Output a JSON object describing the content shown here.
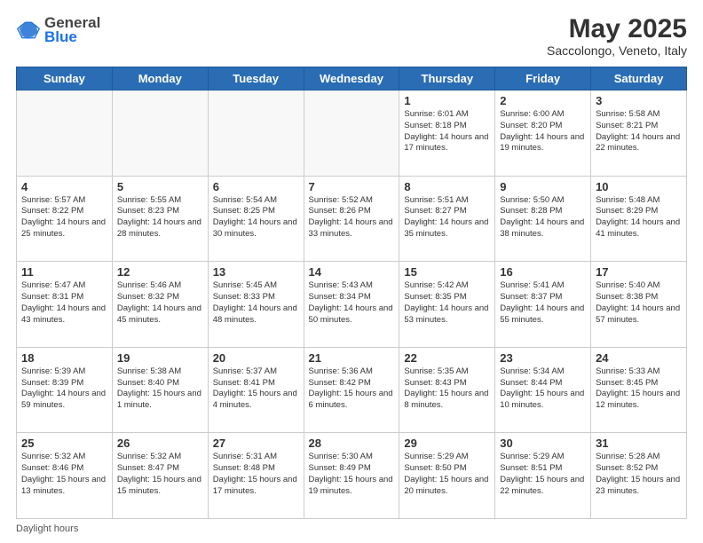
{
  "header": {
    "logo_general": "General",
    "logo_blue": "Blue",
    "month_title": "May 2025",
    "location": "Saccolongo, Veneto, Italy"
  },
  "days_of_week": [
    "Sunday",
    "Monday",
    "Tuesday",
    "Wednesday",
    "Thursday",
    "Friday",
    "Saturday"
  ],
  "weeks": [
    [
      {
        "day": "",
        "info": ""
      },
      {
        "day": "",
        "info": ""
      },
      {
        "day": "",
        "info": ""
      },
      {
        "day": "",
        "info": ""
      },
      {
        "day": "1",
        "info": "Sunrise: 6:01 AM\nSunset: 8:18 PM\nDaylight: 14 hours\nand 17 minutes."
      },
      {
        "day": "2",
        "info": "Sunrise: 6:00 AM\nSunset: 8:20 PM\nDaylight: 14 hours\nand 19 minutes."
      },
      {
        "day": "3",
        "info": "Sunrise: 5:58 AM\nSunset: 8:21 PM\nDaylight: 14 hours\nand 22 minutes."
      }
    ],
    [
      {
        "day": "4",
        "info": "Sunrise: 5:57 AM\nSunset: 8:22 PM\nDaylight: 14 hours\nand 25 minutes."
      },
      {
        "day": "5",
        "info": "Sunrise: 5:55 AM\nSunset: 8:23 PM\nDaylight: 14 hours\nand 28 minutes."
      },
      {
        "day": "6",
        "info": "Sunrise: 5:54 AM\nSunset: 8:25 PM\nDaylight: 14 hours\nand 30 minutes."
      },
      {
        "day": "7",
        "info": "Sunrise: 5:52 AM\nSunset: 8:26 PM\nDaylight: 14 hours\nand 33 minutes."
      },
      {
        "day": "8",
        "info": "Sunrise: 5:51 AM\nSunset: 8:27 PM\nDaylight: 14 hours\nand 35 minutes."
      },
      {
        "day": "9",
        "info": "Sunrise: 5:50 AM\nSunset: 8:28 PM\nDaylight: 14 hours\nand 38 minutes."
      },
      {
        "day": "10",
        "info": "Sunrise: 5:48 AM\nSunset: 8:29 PM\nDaylight: 14 hours\nand 41 minutes."
      }
    ],
    [
      {
        "day": "11",
        "info": "Sunrise: 5:47 AM\nSunset: 8:31 PM\nDaylight: 14 hours\nand 43 minutes."
      },
      {
        "day": "12",
        "info": "Sunrise: 5:46 AM\nSunset: 8:32 PM\nDaylight: 14 hours\nand 45 minutes."
      },
      {
        "day": "13",
        "info": "Sunrise: 5:45 AM\nSunset: 8:33 PM\nDaylight: 14 hours\nand 48 minutes."
      },
      {
        "day": "14",
        "info": "Sunrise: 5:43 AM\nSunset: 8:34 PM\nDaylight: 14 hours\nand 50 minutes."
      },
      {
        "day": "15",
        "info": "Sunrise: 5:42 AM\nSunset: 8:35 PM\nDaylight: 14 hours\nand 53 minutes."
      },
      {
        "day": "16",
        "info": "Sunrise: 5:41 AM\nSunset: 8:37 PM\nDaylight: 14 hours\nand 55 minutes."
      },
      {
        "day": "17",
        "info": "Sunrise: 5:40 AM\nSunset: 8:38 PM\nDaylight: 14 hours\nand 57 minutes."
      }
    ],
    [
      {
        "day": "18",
        "info": "Sunrise: 5:39 AM\nSunset: 8:39 PM\nDaylight: 14 hours\nand 59 minutes."
      },
      {
        "day": "19",
        "info": "Sunrise: 5:38 AM\nSunset: 8:40 PM\nDaylight: 15 hours\nand 1 minute."
      },
      {
        "day": "20",
        "info": "Sunrise: 5:37 AM\nSunset: 8:41 PM\nDaylight: 15 hours\nand 4 minutes."
      },
      {
        "day": "21",
        "info": "Sunrise: 5:36 AM\nSunset: 8:42 PM\nDaylight: 15 hours\nand 6 minutes."
      },
      {
        "day": "22",
        "info": "Sunrise: 5:35 AM\nSunset: 8:43 PM\nDaylight: 15 hours\nand 8 minutes."
      },
      {
        "day": "23",
        "info": "Sunrise: 5:34 AM\nSunset: 8:44 PM\nDaylight: 15 hours\nand 10 minutes."
      },
      {
        "day": "24",
        "info": "Sunrise: 5:33 AM\nSunset: 8:45 PM\nDaylight: 15 hours\nand 12 minutes."
      }
    ],
    [
      {
        "day": "25",
        "info": "Sunrise: 5:32 AM\nSunset: 8:46 PM\nDaylight: 15 hours\nand 13 minutes."
      },
      {
        "day": "26",
        "info": "Sunrise: 5:32 AM\nSunset: 8:47 PM\nDaylight: 15 hours\nand 15 minutes."
      },
      {
        "day": "27",
        "info": "Sunrise: 5:31 AM\nSunset: 8:48 PM\nDaylight: 15 hours\nand 17 minutes."
      },
      {
        "day": "28",
        "info": "Sunrise: 5:30 AM\nSunset: 8:49 PM\nDaylight: 15 hours\nand 19 minutes."
      },
      {
        "day": "29",
        "info": "Sunrise: 5:29 AM\nSunset: 8:50 PM\nDaylight: 15 hours\nand 20 minutes."
      },
      {
        "day": "30",
        "info": "Sunrise: 5:29 AM\nSunset: 8:51 PM\nDaylight: 15 hours\nand 22 minutes."
      },
      {
        "day": "31",
        "info": "Sunrise: 5:28 AM\nSunset: 8:52 PM\nDaylight: 15 hours\nand 23 minutes."
      }
    ]
  ],
  "footer": {
    "daylight_label": "Daylight hours"
  }
}
